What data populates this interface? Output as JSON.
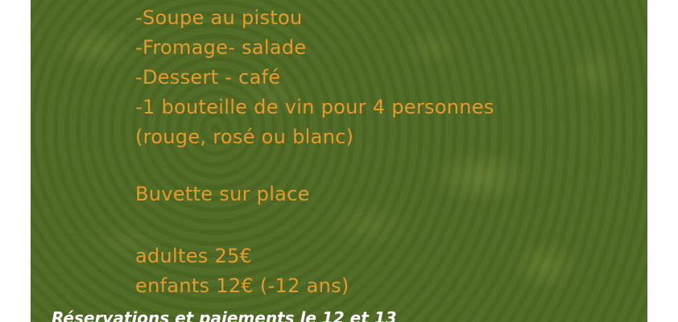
{
  "menu": {
    "items": [
      "-Soupe au pistou",
      "-Fromage- salade",
      "-Dessert - café",
      "-1 bouteille de vin pour 4 personnes",
      "(rouge, rosé ou blanc)"
    ],
    "buvette": "Buvette sur place",
    "prices": {
      "adults": "adultes 25€",
      "children": "enfants 12€ (-12 ans)"
    }
  },
  "footer": {
    "reservation": "Réservations et paiements le 12 et 13"
  },
  "colors": {
    "background": "#4f6a24",
    "text": "#e59a2c",
    "footer_text": "#ffffff"
  }
}
